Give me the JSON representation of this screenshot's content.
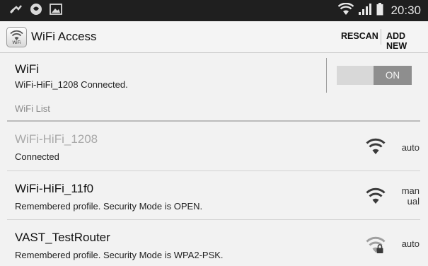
{
  "status_bar": {
    "time": "20:30"
  },
  "action_bar": {
    "app_icon_label": "WiFi",
    "title": "WiFi Access",
    "rescan": "RESCAN",
    "add_new": "ADD NEW"
  },
  "wifi_master": {
    "title": "WiFi",
    "status": "WiFi-HiFi_1208 Connected.",
    "toggle_label": "ON",
    "enabled": true
  },
  "section_label": "WiFi List",
  "networks": [
    {
      "ssid": "WiFi-HiFi_1208",
      "status": "Connected",
      "mode_line1": "auto",
      "mode_line2": "",
      "secured": false,
      "connected": true
    },
    {
      "ssid": "WiFi-HiFi_11f0",
      "status": "Remembered profile.  Security Mode is OPEN.",
      "mode_line1": "man",
      "mode_line2": "ual",
      "secured": false,
      "connected": false
    },
    {
      "ssid": "VAST_TestRouter",
      "status": "Remembered profile.  Security Mode is WPA2-PSK.",
      "mode_line1": "auto",
      "mode_line2": "",
      "secured": true,
      "connected": false
    }
  ]
}
